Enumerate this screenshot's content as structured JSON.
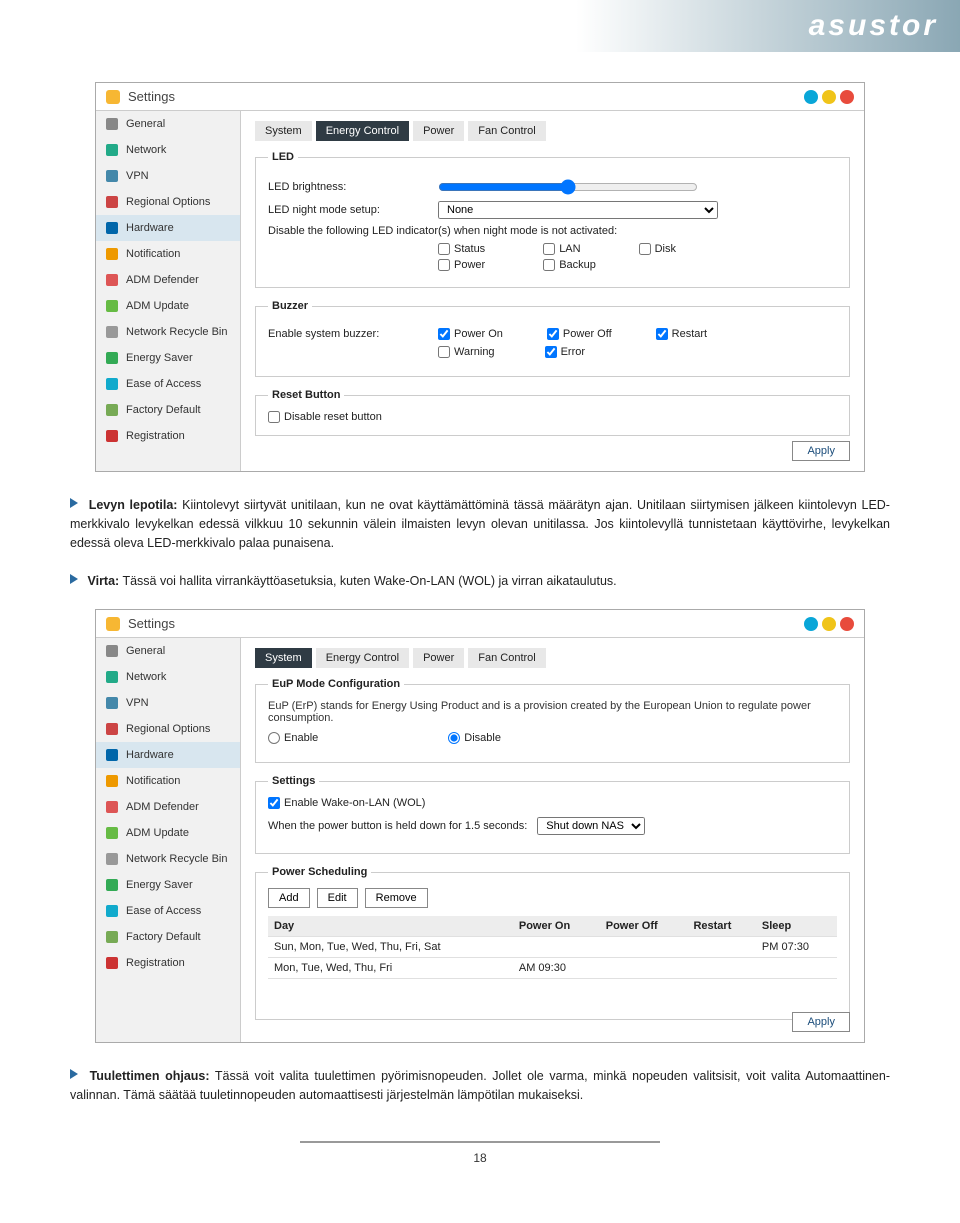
{
  "brand": "asustor",
  "window_title": "Settings",
  "sidebar": {
    "items": [
      {
        "label": "General"
      },
      {
        "label": "Network"
      },
      {
        "label": "VPN"
      },
      {
        "label": "Regional Options"
      },
      {
        "label": "Hardware"
      },
      {
        "label": "Notification"
      },
      {
        "label": "ADM Defender"
      },
      {
        "label": "ADM Update"
      },
      {
        "label": "Network Recycle Bin"
      },
      {
        "label": "Energy Saver"
      },
      {
        "label": "Ease of Access"
      },
      {
        "label": "Factory Default"
      },
      {
        "label": "Registration"
      }
    ]
  },
  "tabs": [
    {
      "label": "System"
    },
    {
      "label": "Energy Control"
    },
    {
      "label": "Power"
    },
    {
      "label": "Fan Control"
    }
  ],
  "screenshot1": {
    "active_tab_index": 1,
    "led": {
      "legend": "LED",
      "brightness_label": "LED brightness:",
      "night_label": "LED night mode setup:",
      "night_value": "None",
      "disable_text": "Disable the following LED indicator(s) when night mode is not activated:",
      "opts_row1": [
        "Status",
        "LAN",
        "Disk"
      ],
      "opts_row2": [
        "Power",
        "Backup"
      ]
    },
    "buzzer": {
      "legend": "Buzzer",
      "enable_label": "Enable system buzzer:",
      "opts_row1": [
        "Power On",
        "Power Off",
        "Restart"
      ],
      "opts_row2": [
        "Warning",
        "Error"
      ]
    },
    "reset": {
      "legend": "Reset Button",
      "disable_label": "Disable reset button"
    },
    "apply": "Apply"
  },
  "para1_label": "Levyn lepotila:",
  "para1": " Kiintolevyt siirtyvät unitilaan, kun ne ovat käyttämättöminä tässä määrätyn ajan. Unitilaan siirtymisen jälkeen kiintolevyn LED-merkkivalo levykelkan edessä vilkkuu 10 sekunnin välein ilmaisten levyn olevan unitilassa. Jos kiintolevyllä tunnistetaan käyttövirhe, levykelkan edessä oleva LED-merkkivalo palaa punaisena.",
  "para2_label": "Virta:",
  "para2": " Tässä voi hallita virrankäyttöasetuksia, kuten Wake-On-LAN (WOL) ja virran aikataulutus.",
  "screenshot2": {
    "active_tab_index": 2,
    "eup": {
      "legend": "EuP Mode Configuration",
      "desc": "EuP (ErP) stands for Energy Using Product and is a provision created by the European Union to regulate power consumption.",
      "enable": "Enable",
      "disable": "Disable"
    },
    "settings": {
      "legend": "Settings",
      "wol": "Enable Wake-on-LAN (WOL)",
      "pb_label": "When the power button is held down for 1.5 seconds:",
      "pb_value": "Shut down NAS"
    },
    "sched": {
      "legend": "Power Scheduling",
      "add": "Add",
      "edit": "Edit",
      "remove": "Remove",
      "headers": [
        "Day",
        "Power On",
        "Power Off",
        "Restart",
        "Sleep"
      ],
      "rows": [
        {
          "day": "Sun, Mon, Tue, Wed, Thu, Fri, Sat",
          "on": "",
          "off": "",
          "re": "",
          "sleep": "PM 07:30"
        },
        {
          "day": "Mon, Tue, Wed, Thu, Fri",
          "on": "AM 09:30",
          "off": "",
          "re": "",
          "sleep": ""
        }
      ]
    },
    "apply": "Apply"
  },
  "para3_label": "Tuulettimen ohjaus:",
  "para3": " Tässä voit valita tuulettimen pyörimisnopeuden. Jollet ole varma, minkä nopeuden valitsisit, voit valita Automaattinen-valinnan. Tämä säätää tuuletinnopeuden automaattisesti järjestelmän lämpötilan mukaiseksi.",
  "page_number": "18"
}
